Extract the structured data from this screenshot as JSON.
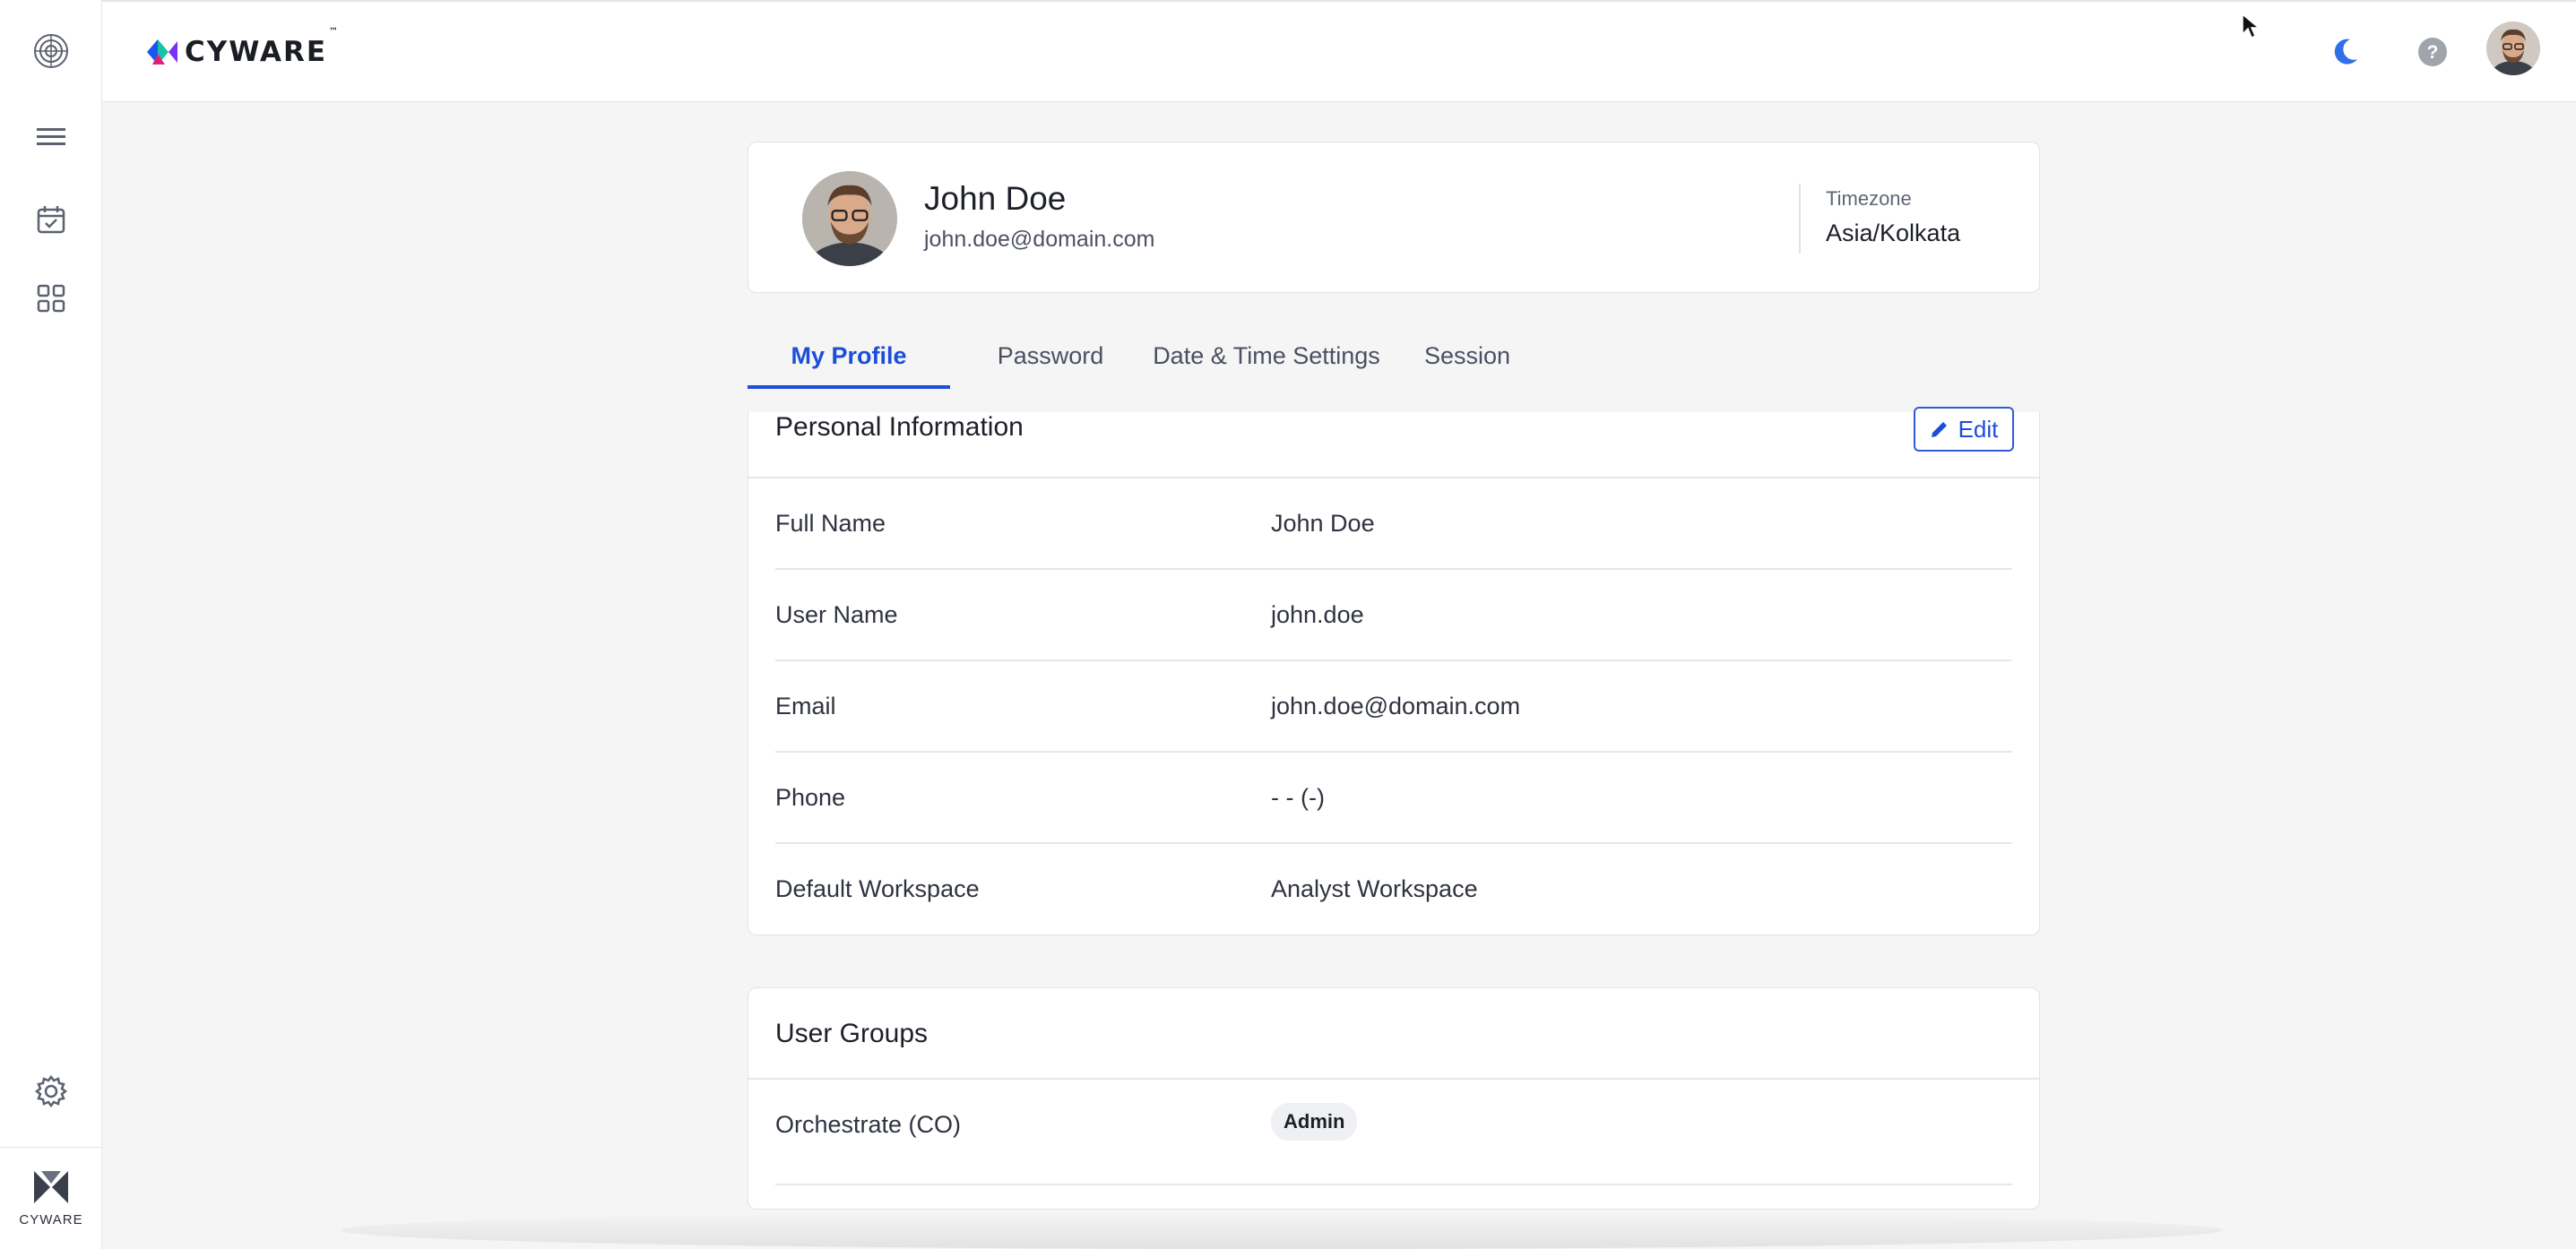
{
  "app": {
    "brand": "CYWARE",
    "brand_tm": "™",
    "rail_brand": "CYWARE",
    "accent_color": "#1d4ed8"
  },
  "sidebar": {
    "items": [
      {
        "icon": "radar-icon"
      },
      {
        "icon": "menu-icon"
      },
      {
        "icon": "calendar-check-icon"
      },
      {
        "icon": "grid-icon"
      },
      {
        "icon": "gear-icon"
      }
    ]
  },
  "topbar": {
    "icons": [
      "moon-icon",
      "help-icon",
      "user-avatar"
    ]
  },
  "profile": {
    "name": "John Doe",
    "email": "john.doe@domain.com",
    "timezone_label": "Timezone",
    "timezone_value": "Asia/Kolkata"
  },
  "tabs": [
    {
      "label": "My Profile",
      "active": true
    },
    {
      "label": "Password",
      "active": false
    },
    {
      "label": "Date & Time Settings",
      "active": false
    },
    {
      "label": "Session",
      "active": false
    }
  ],
  "personal_info": {
    "title": "Personal Information",
    "edit_label": "Edit",
    "rows": [
      {
        "label": "Full Name",
        "value": "John Doe"
      },
      {
        "label": "User Name",
        "value": "john.doe"
      },
      {
        "label": "Email",
        "value": "john.doe@domain.com"
      },
      {
        "label": "Phone",
        "value": "- - (-)"
      },
      {
        "label": "Default Workspace",
        "value": "Analyst Workspace"
      }
    ]
  },
  "user_groups": {
    "title": "User Groups",
    "rows": [
      {
        "label": "Orchestrate (CO)",
        "badge": "Admin"
      }
    ]
  }
}
